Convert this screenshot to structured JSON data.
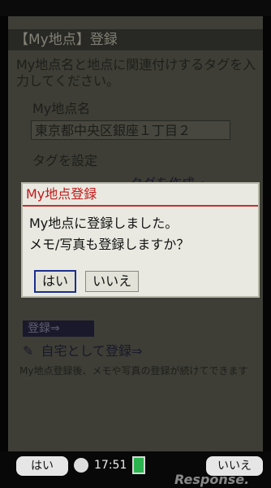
{
  "background_screen": {
    "title": "【My地点】登録",
    "instruction": "My地点名と地点に関連付けするタグを入力してください。",
    "name_label": "My地点名",
    "name_value": "東京都中央区銀座１丁目２",
    "tag_label": "タグを設定",
    "create_tag_link": "タグを作成⇒",
    "register_button": "登録⇒",
    "home_register_link": "自宅として登録⇒",
    "note": "My地点登録後、メモや写真の登録が続けてできます"
  },
  "dialog": {
    "title": "My地点登録",
    "message_line1": "My地点に登録しました。",
    "message_line2": "メモ/写真も登録しますか？",
    "yes_label": "はい",
    "no_label": "いいえ"
  },
  "softbar": {
    "left_label": "はい",
    "time": "17:51",
    "right_label": "いいえ"
  },
  "watermark": "Response."
}
